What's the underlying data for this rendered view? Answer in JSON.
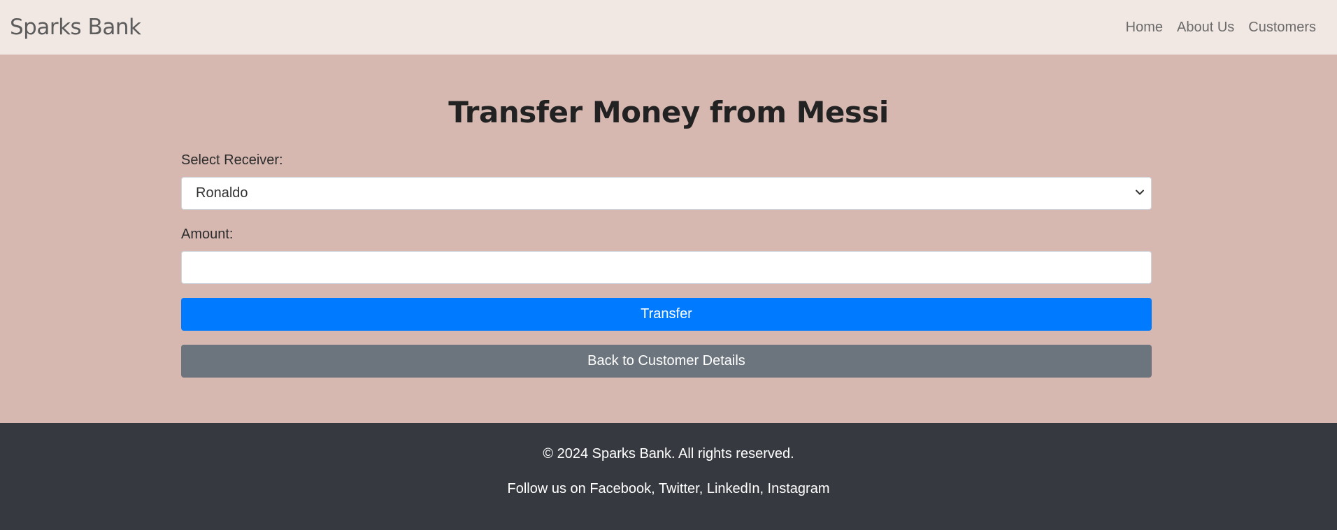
{
  "nav": {
    "brand": "Sparks Bank",
    "links": [
      "Home",
      "About Us",
      "Customers"
    ]
  },
  "main": {
    "title": "Transfer Money from Messi",
    "receiver_label": "Select Receiver:",
    "receiver_value": "Ronaldo",
    "amount_label": "Amount:",
    "amount_value": "",
    "transfer_label": "Transfer",
    "back_label": "Back to Customer Details"
  },
  "footer": {
    "copyright": "© 2024 Sparks Bank. All rights reserved.",
    "follow": "Follow us on Facebook, Twitter, LinkedIn, Instagram"
  },
  "colors": {
    "nav_bg": "#f2e8e3",
    "page_bg": "#d7b8b1",
    "primary": "#007bff",
    "secondary": "#6c757d",
    "footer_bg": "#363a40"
  },
  "icons": {
    "select_chevron": "chevron-down-icon"
  }
}
